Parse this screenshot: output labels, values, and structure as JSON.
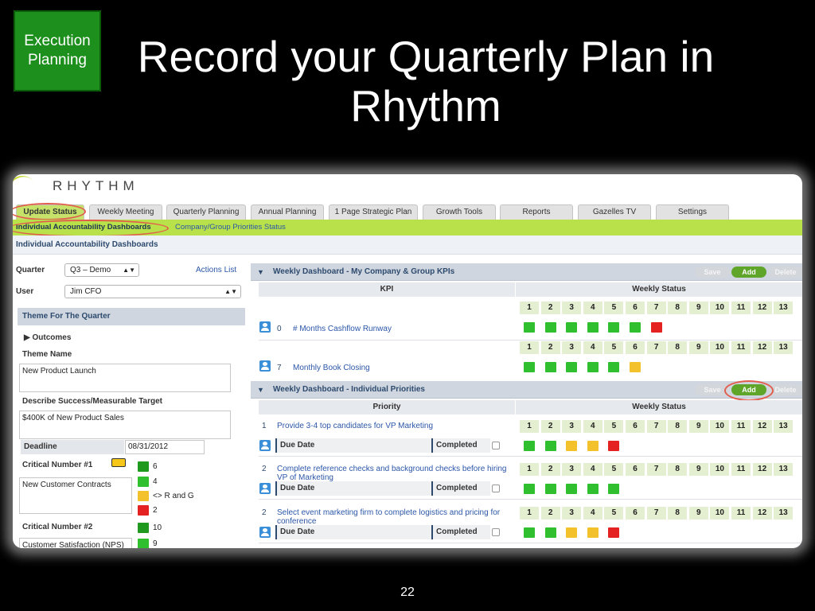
{
  "slide": {
    "badge": "Execution Planning",
    "title": "Record your Quarterly Plan in Rhythm",
    "page_number": "22"
  },
  "app": {
    "logo": "RHYTHM",
    "tabs": [
      "Update Status",
      "Weekly Meeting",
      "Quarterly Planning",
      "Annual Planning",
      "1 Page Strategic Plan",
      "Growth Tools",
      "Reports",
      "Gazelles TV",
      "Settings"
    ],
    "subnav": [
      "Individual Accountability Dashboards",
      "Company/Group Priorities Status"
    ],
    "section_title": "Individual Accountability Dashboards"
  },
  "left": {
    "quarter_label": "Quarter",
    "quarter_value": "Q3 – Demo",
    "user_label": "User",
    "user_value": "Jim CFO",
    "actions_link": "Actions List",
    "theme_header": "Theme For The Quarter",
    "outcomes": "Outcomes",
    "theme_name_label": "Theme Name",
    "theme_name_value": "New Product Launch",
    "target_label": "Describe Success/Measurable Target",
    "target_value": "$400K of New Product Sales",
    "deadline_label": "Deadline",
    "deadline_value": "08/31/2012",
    "cn1_label": "Critical Number #1",
    "cn1_text": "New Customer Contracts",
    "cn1_levels": [
      "6",
      "4",
      "<> R and G",
      "2"
    ],
    "cn2_label": "Critical Number #2",
    "cn2_value": "10",
    "cn2_text": "Customer Satisfaction (NPS)",
    "cn2_next": "9"
  },
  "kpi_section": {
    "title": "Weekly Dashboard - My Company & Group KPIs",
    "buttons": {
      "save": "Save",
      "add": "Add",
      "delete": "Delete"
    },
    "col_kpi": "KPI",
    "col_status": "Weekly Status",
    "weeks": [
      "1",
      "2",
      "3",
      "4",
      "5",
      "6",
      "7",
      "8",
      "9",
      "10",
      "11",
      "12",
      "13"
    ],
    "rows": [
      {
        "index": "0",
        "name": "# Months Cashflow Runway",
        "status": [
          "green",
          "green",
          "green",
          "green",
          "green",
          "green",
          "red"
        ]
      },
      {
        "index": "7",
        "name": "Monthly Book Closing",
        "status": [
          "green",
          "green",
          "green",
          "green",
          "green",
          "yellow"
        ]
      }
    ]
  },
  "pri_section": {
    "title": "Weekly Dashboard - Individual Priorities",
    "buttons": {
      "save": "Save",
      "add": "Add",
      "delete": "Delete"
    },
    "col_priority": "Priority",
    "col_status": "Weekly Status",
    "due_label": "Due Date",
    "completed_label": "Completed",
    "rows": [
      {
        "index": "1",
        "name": "Provide 3-4 top candidates for VP Marketing",
        "status": [
          "green",
          "green",
          "yellow",
          "yellow",
          "red"
        ]
      },
      {
        "index": "2",
        "name": "Complete reference checks and background checks before hiring VP of Marketing",
        "status": [
          "green",
          "green",
          "green",
          "green",
          "green"
        ]
      },
      {
        "index": "2",
        "name": "Select event marketing firm to complete logistics and pricing for conference",
        "status": [
          "green",
          "green",
          "yellow",
          "yellow",
          "red"
        ]
      }
    ]
  },
  "colors": {
    "badge_green": "#1c8f1c",
    "nav_green": "#b9e24a",
    "status_green": "#2fbf2f",
    "status_yellow": "#f2c12b",
    "status_red": "#e52222",
    "highlight_ring": "#e25d4e"
  }
}
